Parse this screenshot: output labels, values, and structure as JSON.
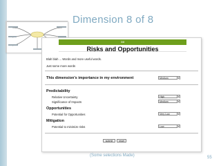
{
  "slide": {
    "title": "Dimension 8 of 8",
    "caption": "(Some selections Made)",
    "number": "55"
  },
  "page": {
    "bar_text": "3/8",
    "heading": "Risks and Opportunities",
    "intro_line": "Blah blah ... Words and more useful words.",
    "intro_line2": "Just some more words",
    "importance_label": "This dimension's importance in my environment",
    "importance_value": "Medium",
    "sections": [
      {
        "title": "Predictability",
        "items": [
          {
            "label": "Relative Uncertainty",
            "value": "High"
          },
          {
            "label": "Significance of Impacts",
            "value": "Medium"
          }
        ]
      },
      {
        "title": "Opportunities",
        "items": [
          {
            "label": "Potential for Opportunities",
            "value": "Very Low"
          }
        ]
      },
      {
        "title": "Mitigation",
        "items": [
          {
            "label": "Potential to minimize risks",
            "value": "Low"
          }
        ]
      }
    ],
    "buttons": {
      "submit": "submit",
      "reset": "reset"
    }
  },
  "colors": {
    "accent_title": "#7fa9c1",
    "bar_green": "#6e9f1c"
  }
}
